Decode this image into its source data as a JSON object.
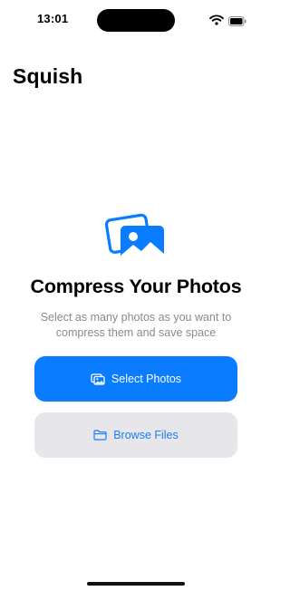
{
  "status_bar": {
    "time": "13:01",
    "icons": [
      "wifi-icon",
      "battery-icon"
    ]
  },
  "app": {
    "title": "Squish"
  },
  "main": {
    "hero_icon": "photos-icon",
    "headline": "Compress Your Photos",
    "subtitle": "Select as many photos as you want to compress them and save space"
  },
  "actions": {
    "select_photos": {
      "label": "Select Photos",
      "icon": "photo-stack-icon"
    },
    "browse_files": {
      "label": "Browse Files",
      "icon": "folder-icon"
    }
  },
  "colors": {
    "accent": "#0a7cff",
    "secondary_button_bg": "#e6e6eb",
    "subtitle_text": "#8a8a8e"
  }
}
